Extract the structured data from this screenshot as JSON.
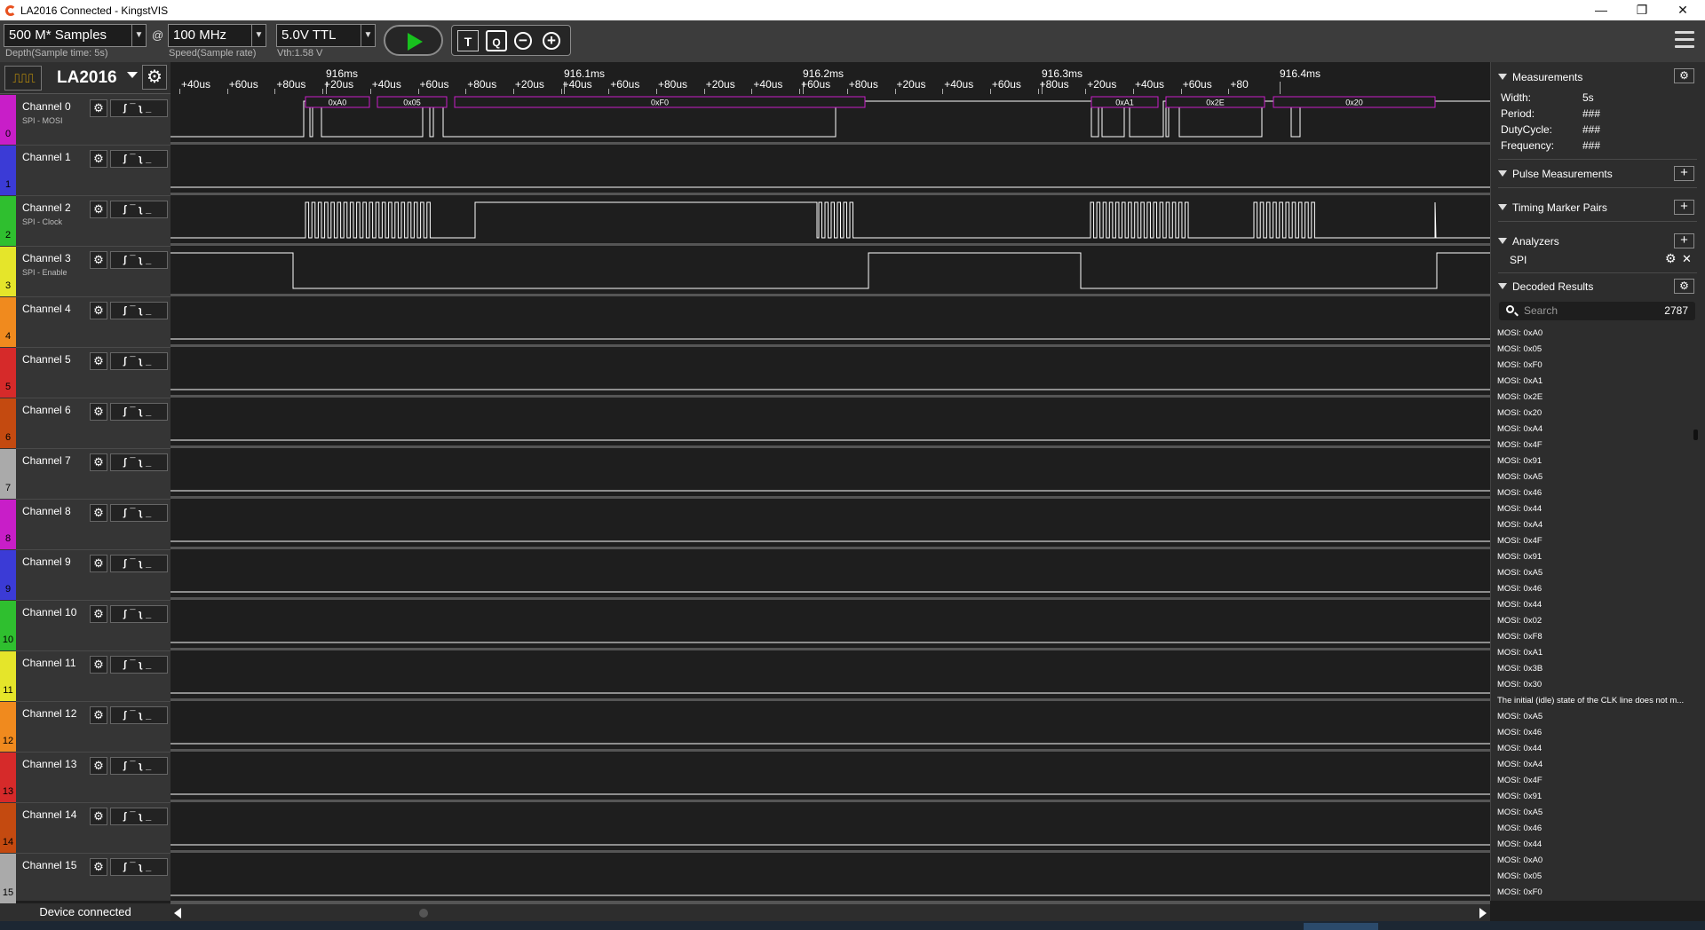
{
  "window": {
    "title": "LA2016 Connected - KingstVIS",
    "minimize": "—",
    "maximize": "❐",
    "close": "✕"
  },
  "toolbar": {
    "depth_value": "500 M* Samples",
    "at_symbol": "@",
    "speed_value": "100 MHz",
    "threshold_value": "5.0V TTL",
    "depth_hint": "Depth(Sample time: 5s)",
    "speed_hint": "Speed(Sample rate)",
    "threshold_hint": "Vth:1.58 V",
    "run_button": "Start",
    "tools": [
      "T",
      "Q",
      "−",
      "+"
    ]
  },
  "device": {
    "name": "LA2016",
    "logo": "⎍⎍⎍"
  },
  "ruler": {
    "major_labels": [
      "916ms",
      "916.1ms",
      "916.2ms",
      "916.3ms",
      "916.4ms"
    ],
    "minor_labels": [
      "+40us",
      "+60us",
      "+80us",
      "+20us",
      "+40us",
      "+60us",
      "+80us",
      "+20us",
      "+40us",
      "+60us",
      "+80us",
      "+20us",
      "+40us",
      "+60us",
      "+80us",
      "+20us",
      "+40us",
      "+60us",
      "+80us",
      "+20us",
      "+40us",
      "+60us",
      "+80"
    ]
  },
  "channels": [
    {
      "name": "Channel 0",
      "sub": "SPI - MOSI",
      "num": "0",
      "color": "#c81ec8"
    },
    {
      "name": "Channel 1",
      "sub": "",
      "num": "1",
      "color": "#3b3bd6"
    },
    {
      "name": "Channel 2",
      "sub": "SPI - Clock",
      "num": "2",
      "color": "#2fbf2f"
    },
    {
      "name": "Channel 3",
      "sub": "SPI - Enable",
      "num": "3",
      "color": "#e5e52a"
    },
    {
      "name": "Channel 4",
      "sub": "",
      "num": "4",
      "color": "#f08a1e"
    },
    {
      "name": "Channel 5",
      "sub": "",
      "num": "5",
      "color": "#d62a2a"
    },
    {
      "name": "Channel 6",
      "sub": "",
      "num": "6",
      "color": "#c44a10"
    },
    {
      "name": "Channel 7",
      "sub": "",
      "num": "7",
      "color": "#aaaaaa"
    },
    {
      "name": "Channel 8",
      "sub": "",
      "num": "8",
      "color": "#c81ec8"
    },
    {
      "name": "Channel 9",
      "sub": "",
      "num": "9",
      "color": "#3b3bd6"
    },
    {
      "name": "Channel 10",
      "sub": "",
      "num": "10",
      "color": "#2fbf2f"
    },
    {
      "name": "Channel 11",
      "sub": "",
      "num": "11",
      "color": "#e5e52a"
    },
    {
      "name": "Channel 12",
      "sub": "",
      "num": "12",
      "color": "#f08a1e"
    },
    {
      "name": "Channel 13",
      "sub": "",
      "num": "13",
      "color": "#d62a2a"
    },
    {
      "name": "Channel 14",
      "sub": "",
      "num": "14",
      "color": "#c44a10"
    },
    {
      "name": "Channel 15",
      "sub": "",
      "num": "15",
      "color": "#aaaaaa"
    }
  ],
  "decoder_labels": [
    "0xA0",
    "0x05",
    "0xF0",
    "0xA1",
    "0x2E",
    "0x20"
  ],
  "status": "Device connected",
  "measurements": {
    "title": "Measurements",
    "rows": [
      {
        "label": "Width:",
        "value": "5s"
      },
      {
        "label": "Period:",
        "value": "###"
      },
      {
        "label": "DutyCycle:",
        "value": "###"
      },
      {
        "label": "Frequency:",
        "value": "###"
      }
    ]
  },
  "pulse_measurements": {
    "title": "Pulse Measurements"
  },
  "timing_markers": {
    "title": "Timing Marker Pairs"
  },
  "analyzers": {
    "title": "Analyzers",
    "items": [
      "SPI"
    ]
  },
  "decoded_results": {
    "title": "Decoded Results",
    "search_placeholder": "Search",
    "count": "2787",
    "items": [
      "MOSI: 0xA0",
      "MOSI: 0x05",
      "MOSI: 0xF0",
      "MOSI: 0xA1",
      "MOSI: 0x2E",
      "MOSI: 0x20",
      "MOSI: 0xA4",
      "MOSI: 0x4F",
      "MOSI: 0x91",
      "MOSI: 0xA5",
      "MOSI: 0x46",
      "MOSI: 0x44",
      "MOSI: 0xA4",
      "MOSI: 0x4F",
      "MOSI: 0x91",
      "MOSI: 0xA5",
      "MOSI: 0x46",
      "MOSI: 0x44",
      "MOSI: 0x02",
      "MOSI: 0xF8",
      "MOSI: 0xA1",
      "MOSI: 0x3B",
      "MOSI: 0x30",
      "The initial (idle) state of the CLK line does not m...",
      "MOSI: 0xA5",
      "MOSI: 0x46",
      "MOSI: 0x44",
      "MOSI: 0xA4",
      "MOSI: 0x4F",
      "MOSI: 0x91",
      "MOSI: 0xA5",
      "MOSI: 0x46",
      "MOSI: 0x44",
      "MOSI: 0xA0",
      "MOSI: 0x05",
      "MOSI: 0xF0"
    ]
  }
}
